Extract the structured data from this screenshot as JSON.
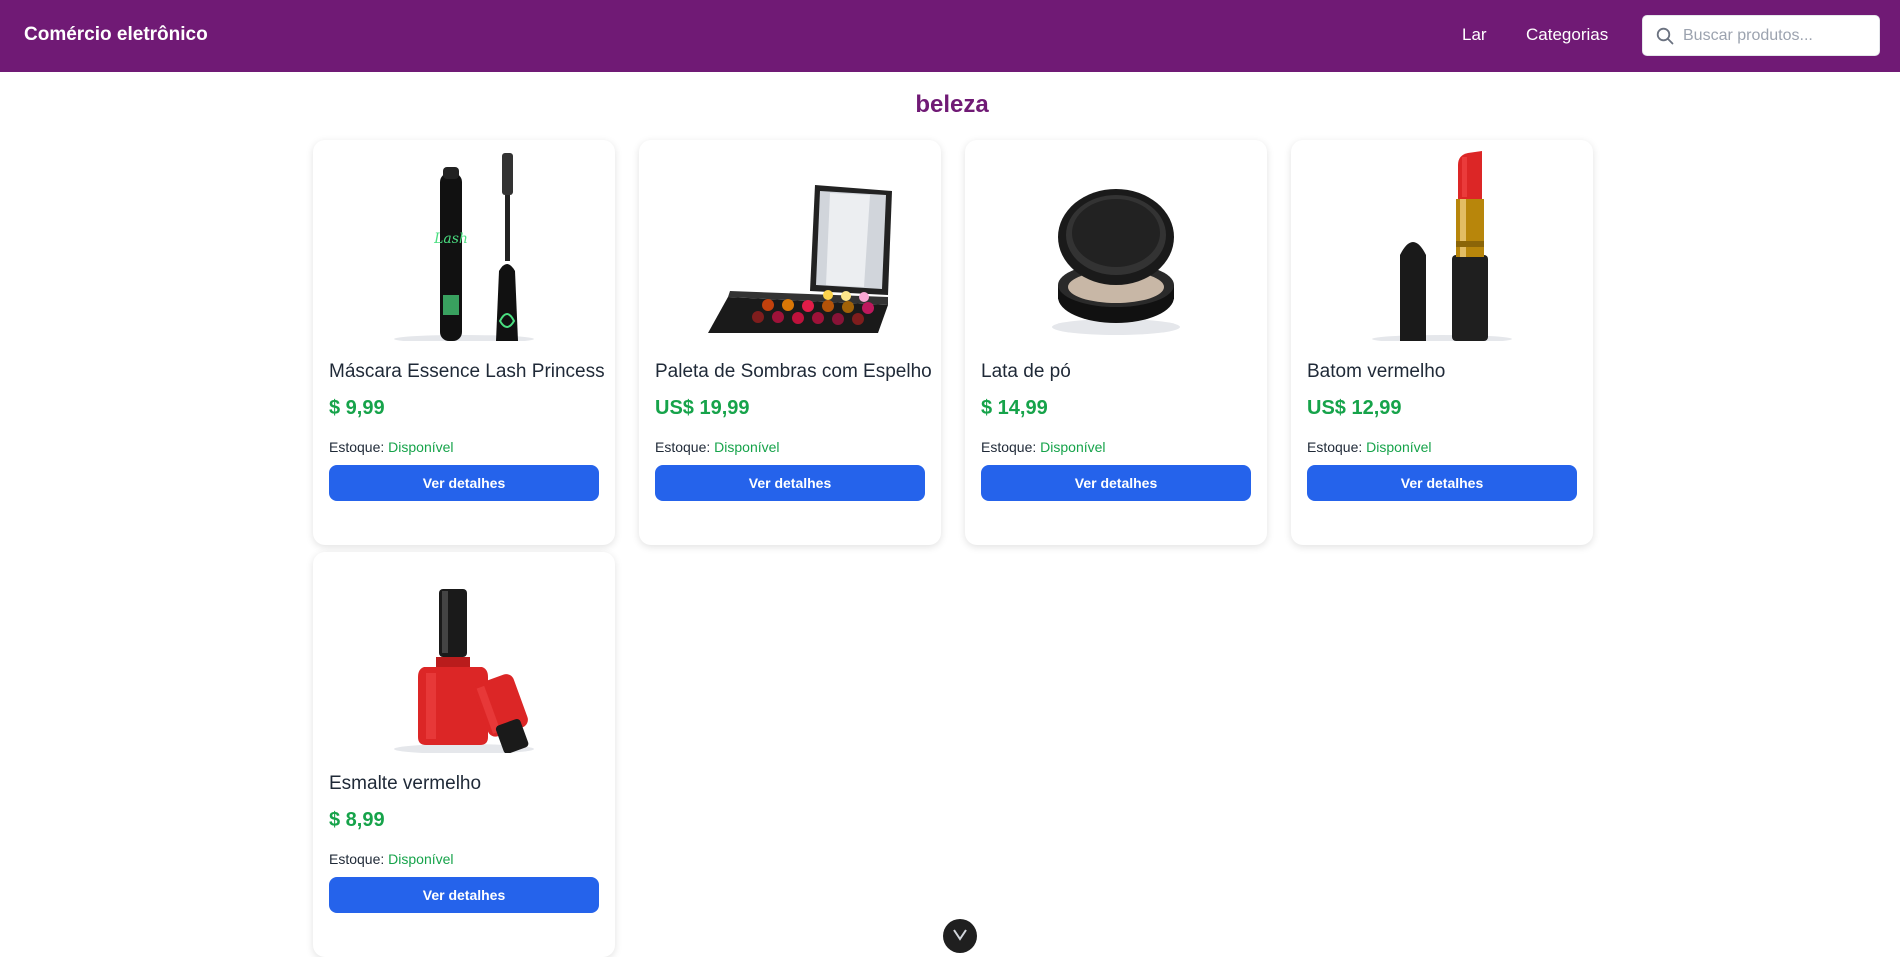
{
  "header": {
    "brand": "Comércio eletrônico",
    "nav": [
      "Lar",
      "Categorias"
    ],
    "search_placeholder": "Buscar produtos..."
  },
  "page_title": "beleza",
  "stock_label": "Estoque:",
  "details_label": "Ver detalhes",
  "products": [
    {
      "name": "Máscara Essence Lash Princess",
      "price": "$ 9,99",
      "stock": "Disponível",
      "icon": "mascara-icon"
    },
    {
      "name": "Paleta de Sombras com Espelho",
      "price": "US$ 19,99",
      "stock": "Disponível",
      "icon": "eyeshadow-palette-icon"
    },
    {
      "name": "Lata de pó",
      "price": "$ 14,99",
      "stock": "Disponível",
      "icon": "powder-compact-icon"
    },
    {
      "name": "Batom vermelho",
      "price": "US$ 12,99",
      "stock": "Disponível",
      "icon": "red-lipstick-icon"
    },
    {
      "name": "Esmalte vermelho",
      "price": "$ 8,99",
      "stock": "Disponível",
      "icon": "red-nail-polish-icon"
    }
  ],
  "colors": {
    "header_bg": "#701a75",
    "price": "#16a34a",
    "button": "#2563eb"
  }
}
